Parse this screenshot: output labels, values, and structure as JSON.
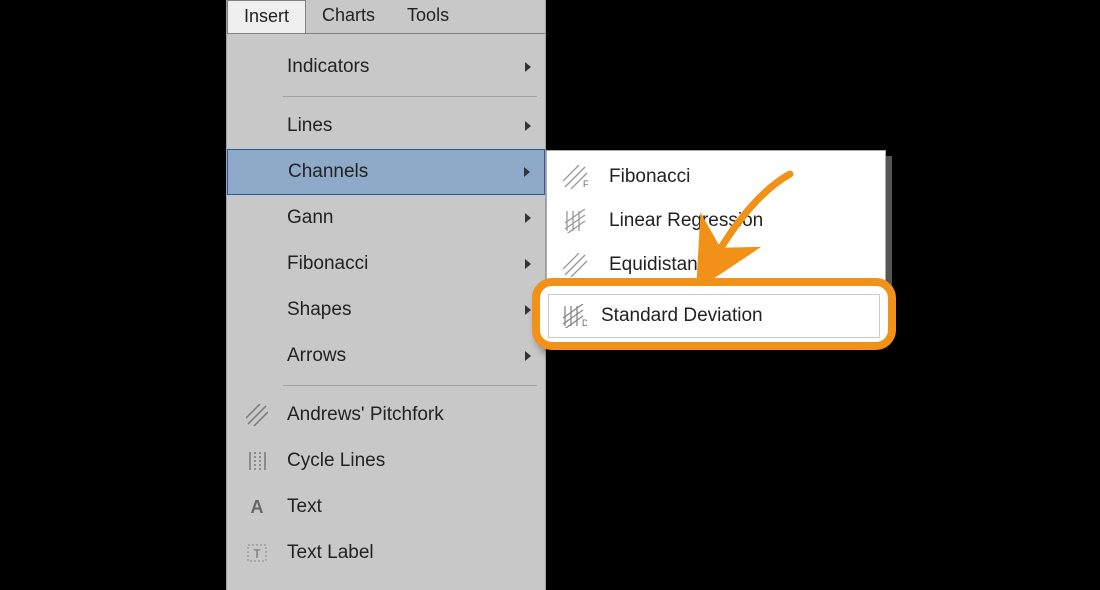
{
  "menubar": {
    "tabs": [
      {
        "label": "Insert",
        "active": true
      },
      {
        "label": "Charts",
        "active": false
      },
      {
        "label": "Tools",
        "active": false
      }
    ]
  },
  "dropdown": {
    "groups": [
      [
        {
          "label": "Indicators",
          "has_submenu": true
        }
      ],
      [
        {
          "label": "Lines",
          "has_submenu": true
        },
        {
          "label": "Channels",
          "has_submenu": true,
          "highlight": true
        },
        {
          "label": "Gann",
          "has_submenu": true
        },
        {
          "label": "Fibonacci",
          "has_submenu": true
        },
        {
          "label": "Shapes",
          "has_submenu": true
        },
        {
          "label": "Arrows",
          "has_submenu": true
        }
      ],
      [
        {
          "label": "Andrews' Pitchfork",
          "icon": "hatch-icon"
        },
        {
          "label": "Cycle Lines",
          "icon": "vlines-icon"
        },
        {
          "label": "Text",
          "icon": "letter-a-icon"
        },
        {
          "label": "Text Label",
          "icon": "text-box-icon"
        }
      ]
    ]
  },
  "submenu": {
    "items": [
      {
        "label": "Fibonacci",
        "icon": "hatch-f-icon"
      },
      {
        "label": "Linear Regression",
        "icon": "hatch-r-icon"
      },
      {
        "label": "Equidistant",
        "icon": "hatch-e-icon"
      },
      {
        "label": "Standard Deviation",
        "icon": "hatch-d-icon",
        "highlighted": true
      }
    ]
  },
  "colors": {
    "callout_border": "#f29118",
    "highlight_bg": "#8fa9c9"
  }
}
